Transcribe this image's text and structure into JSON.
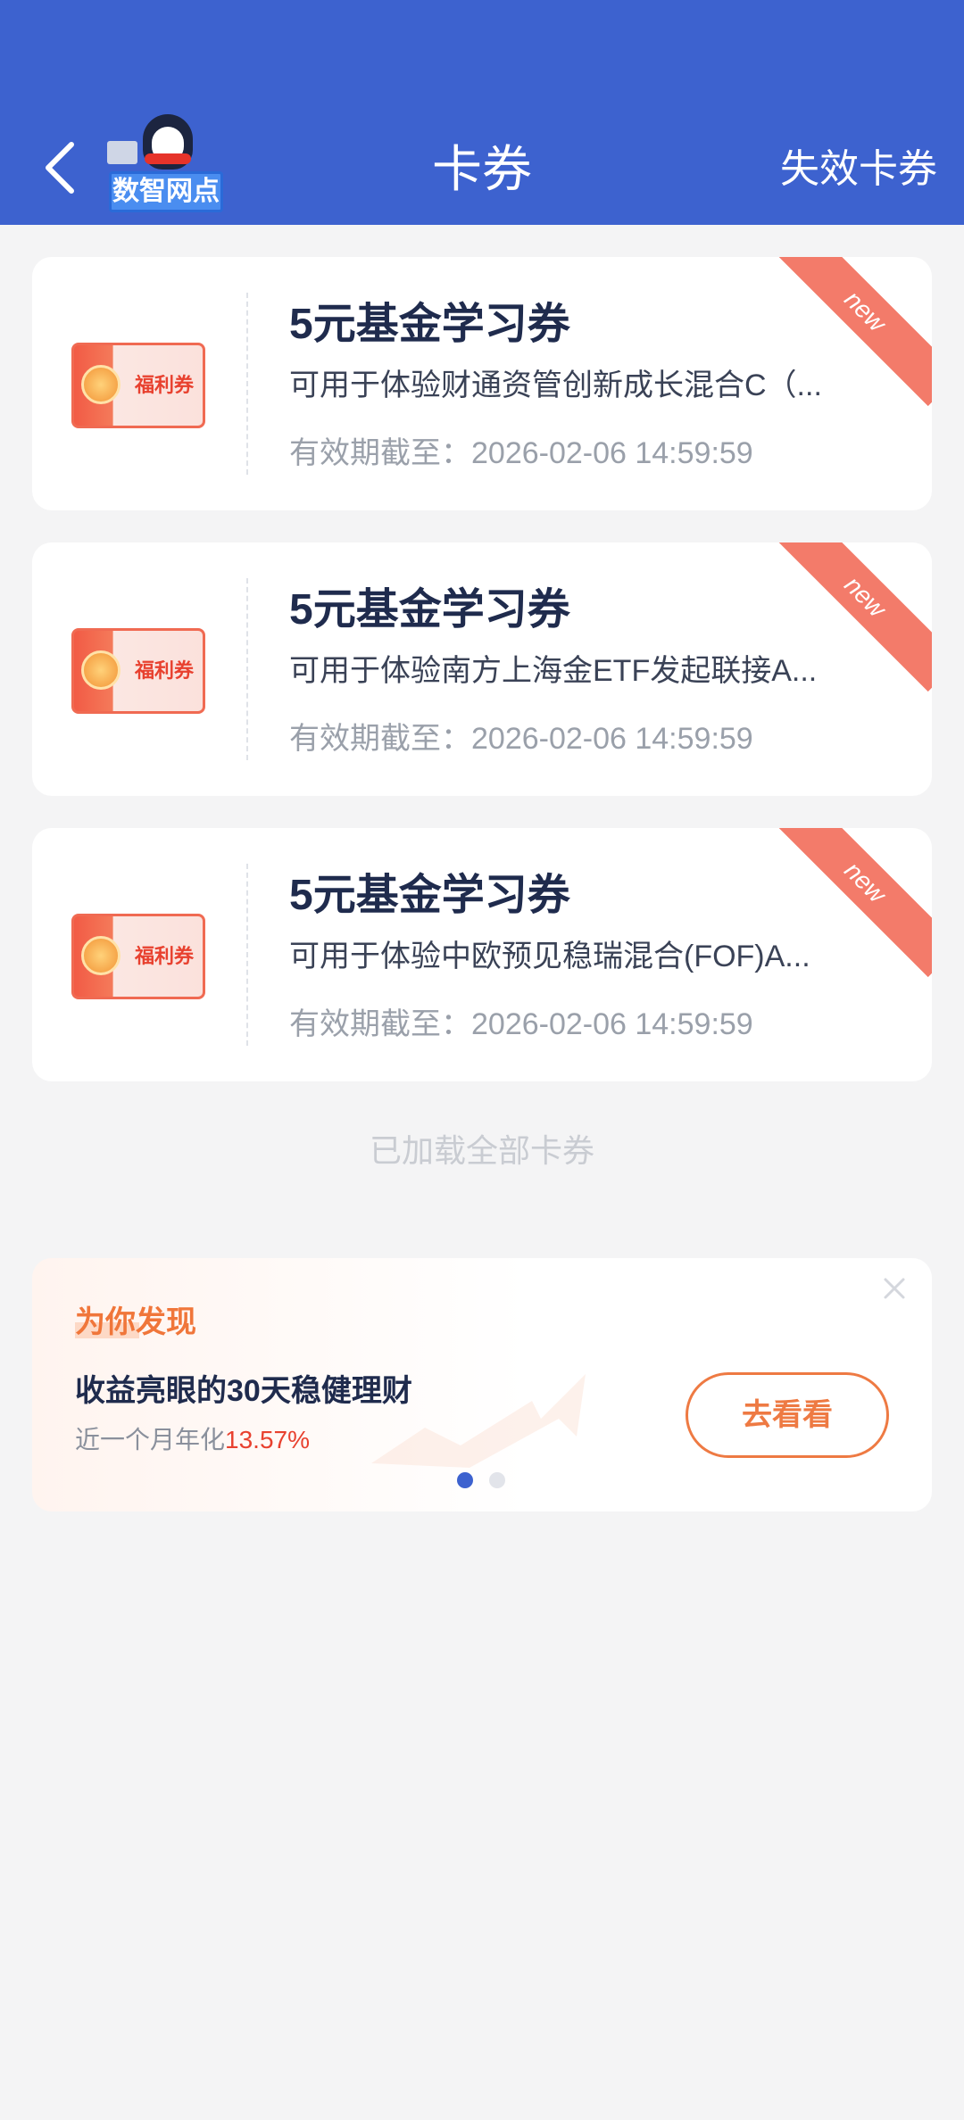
{
  "header": {
    "title": "卡券",
    "expired_label": "失效卡券",
    "logo_text": "数智网点",
    "background_color": "#3d62cf"
  },
  "coupons": [
    {
      "thumb_label": "福利券",
      "title": "5元基金学习券",
      "description": "可用于体验财通资管创新成长混合C（...",
      "expiry_label": "有效期截至：",
      "expiry_value": "2026-02-06 14:59:59",
      "ribbon": "new"
    },
    {
      "thumb_label": "福利券",
      "title": "5元基金学习券",
      "description": "可用于体验南方上海金ETF发起联接A...",
      "expiry_label": "有效期截至：",
      "expiry_value": "2026-02-06 14:59:59",
      "ribbon": "new"
    },
    {
      "thumb_label": "福利券",
      "title": "5元基金学习券",
      "description": "可用于体验中欧预见稳瑞混合(FOF)A...",
      "expiry_label": "有效期截至：",
      "expiry_value": "2026-02-06 14:59:59",
      "ribbon": "new"
    }
  ],
  "list_footer": "已加载全部卡券",
  "promo": {
    "tag": "为你发现",
    "headline": "收益亮眼的30天稳健理财",
    "sub_prefix": "近一个月年化",
    "sub_rate": "13.57%",
    "button_label": "去看看",
    "accent_color": "#ee7a43",
    "carousel_pages": 2,
    "carousel_active": 1
  }
}
